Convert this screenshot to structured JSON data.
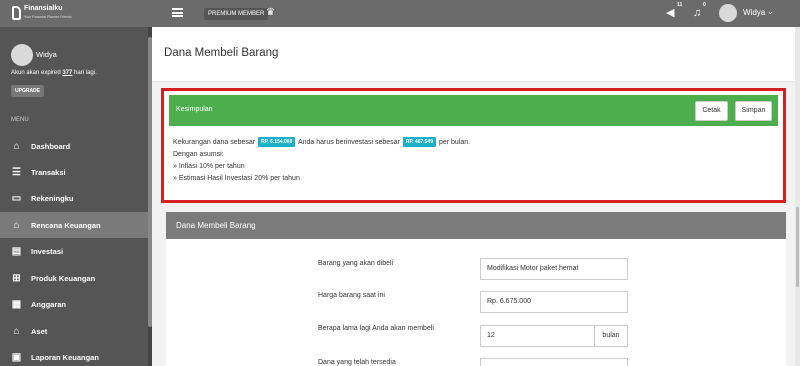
{
  "topbar": {
    "logo": "Finansialku",
    "logo_sub": "Your Financial Planner Friends",
    "premium_label": "PREMIUM MEMBER",
    "notif_a_count": "11",
    "notif_b_count": "0",
    "user": "Widya",
    "caret": "⌄"
  },
  "sidebar": {
    "user": "Widya",
    "expire_prefix": "Akun akan expired ",
    "expire_days": "377",
    "expire_suffix": " hari lagi.",
    "upgrade": "UPGRADE",
    "menu_label": "MENU",
    "items": [
      {
        "label": "Dashboard",
        "icon": "dashboard-icon",
        "glyph": "⌂"
      },
      {
        "label": "Transaksi",
        "icon": "transaction-icon",
        "glyph": "☰"
      },
      {
        "label": "Rekeningku",
        "icon": "bank-account-icon",
        "glyph": "▭"
      },
      {
        "label": "Rencana Keuangan",
        "icon": "bank-icon",
        "glyph": "⌂"
      },
      {
        "label": "Investasi",
        "icon": "investment-icon",
        "glyph": "▤"
      },
      {
        "label": "Produk Keuangan",
        "icon": "cart-icon",
        "glyph": "⊞"
      },
      {
        "label": "Anggaran",
        "icon": "budget-icon",
        "glyph": "▦"
      },
      {
        "label": "Aset",
        "icon": "asset-icon",
        "glyph": "⌂"
      },
      {
        "label": "Laporan Keuangan",
        "icon": "report-icon",
        "glyph": "▣"
      }
    ]
  },
  "main": {
    "page_title": "Dana Membeli Barang",
    "summary": {
      "title": "Kesimpulan",
      "print_label": "Cetak",
      "save_label": "Simpan",
      "line1_a": "Kekurangan dana sebesar ",
      "shortfall": "RP. 6.154.069",
      "line1_b": " Anda harus berinvestasi sebesar ",
      "monthly": "RP. 467.549",
      "line1_c": " per bulan.",
      "line2": "Dengan asumsi:",
      "line3": "» Inflasi 10% per tahun",
      "line4": "» Estimasi Hasil Investasi 20% per tahun"
    },
    "form": {
      "title": "Dana Membeli Barang",
      "item_label": "Barang yang akan dibeli",
      "item_value": "Modifikasi Motor paket hemat",
      "price_label": "Harga barang saat ini",
      "price_value": "Rp. 6.675.000",
      "duration_label": "Berapa lama lagi Anda akan membeli",
      "duration_value": "12",
      "duration_unit": "bulan",
      "funds_label": "Dana yang telah tersedia"
    }
  },
  "colors": {
    "topbar": "#6b6b6b",
    "sidebar": "#555555",
    "summary_header": "#4cae4c",
    "highlight_outline": "#d61f1f",
    "value_pill": "#1ab0c8",
    "form_header": "#7b7b7b"
  }
}
